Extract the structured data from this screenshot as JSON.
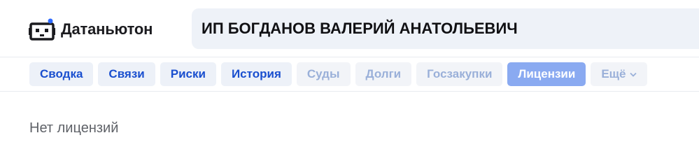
{
  "app": {
    "logo_text": "Датаньютон",
    "logo_icon": "robot-icon",
    "colors": {
      "accent": "#1a4fcf",
      "selected_tab_bg": "#8aaaf1",
      "search_bg": "#eef2f8"
    }
  },
  "search": {
    "value": "ИП БОГДАНОВ ВАЛЕРИЙ АНАТОЛЬЕВИЧ"
  },
  "tabs": [
    {
      "label": "Сводка",
      "state": "enabled"
    },
    {
      "label": "Связи",
      "state": "enabled"
    },
    {
      "label": "Риски",
      "state": "enabled"
    },
    {
      "label": "История",
      "state": "enabled"
    },
    {
      "label": "Суды",
      "state": "disabled"
    },
    {
      "label": "Долги",
      "state": "disabled"
    },
    {
      "label": "Госзакупки",
      "state": "disabled"
    },
    {
      "label": "Лицензии",
      "state": "selected"
    },
    {
      "label": "Ещё",
      "state": "disabled",
      "icon": "chevron-down-icon"
    }
  ],
  "content": {
    "empty_message": "Нет лицензий"
  }
}
